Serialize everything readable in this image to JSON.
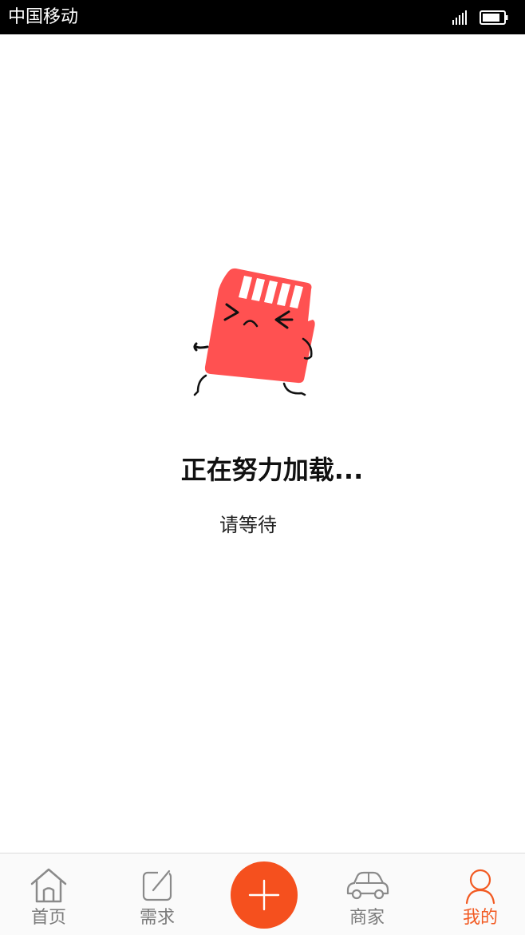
{
  "status_bar": {
    "carrier": "中国移动",
    "signal_icon": "signal-bars-icon",
    "battery_icon": "battery-icon"
  },
  "loading": {
    "mascot_icon": "sd-card-mascot-icon",
    "title": "正在努力加载...",
    "subtitle": "请等待",
    "mascot_color": "#ff5151"
  },
  "tab_bar": {
    "tabs": [
      {
        "label": "首页",
        "icon": "home-icon",
        "active": false
      },
      {
        "label": "需求",
        "icon": "edit-icon",
        "active": false
      },
      {
        "label": "",
        "icon": "plus-icon",
        "active": false
      },
      {
        "label": "商家",
        "icon": "car-icon",
        "active": false
      },
      {
        "label": "我的",
        "icon": "user-icon",
        "active": true
      }
    ],
    "active_color": "#f25a22",
    "inactive_color": "#7a7a7a",
    "add_button_color": "#f5501e"
  }
}
